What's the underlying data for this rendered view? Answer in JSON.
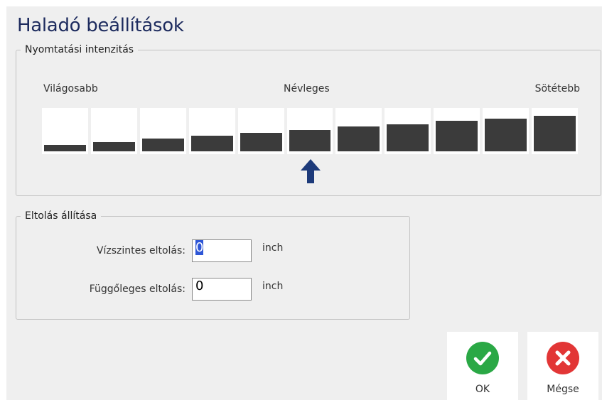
{
  "dialog": {
    "title": "Haladó beállítások"
  },
  "intensity": {
    "legend": "Nyomtatási intenzitás",
    "scale_labels": {
      "lighter": "Világosabb",
      "nominal": "Névleges",
      "darker": "Sötétebb"
    },
    "levels": [
      0.15,
      0.22,
      0.29,
      0.36,
      0.42,
      0.49,
      0.57,
      0.63,
      0.7,
      0.76,
      0.82
    ],
    "selected_index": 5,
    "bar_color": "#3b3b3b",
    "arrow_color": "#1d3a7a"
  },
  "offset": {
    "legend": "Eltolás állítása",
    "horizontal": {
      "label": "Vízszintes eltolás:",
      "value": "0",
      "unit": "inch"
    },
    "vertical": {
      "label": "Függőleges eltolás:",
      "value": "0",
      "unit": "inch"
    }
  },
  "buttons": {
    "ok": {
      "label": "OK",
      "icon": "checkmark-icon",
      "color": "#2aa845"
    },
    "cancel": {
      "label": "Mégse",
      "icon": "close-icon",
      "color": "#e23636"
    }
  }
}
